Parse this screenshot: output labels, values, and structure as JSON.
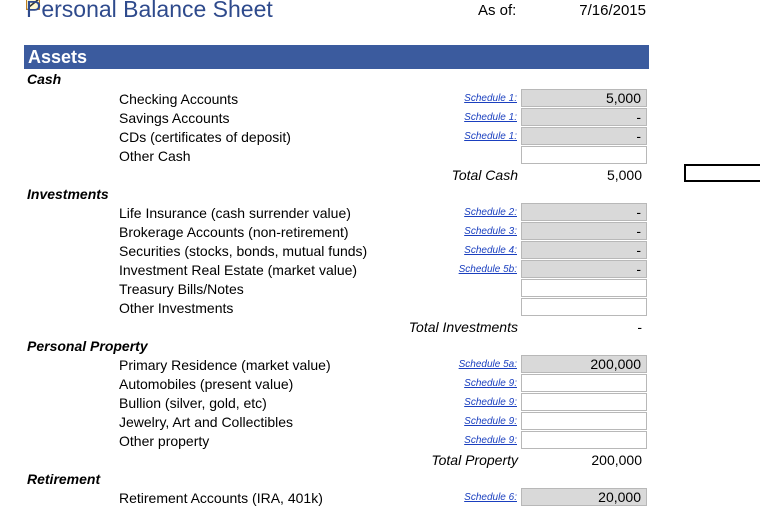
{
  "header": {
    "title": "Personal Balance Sheet",
    "as_of_label": "As of:",
    "as_of_date": "7/16/2015"
  },
  "assets_label": "Assets",
  "sections": {
    "cash": {
      "label": "Cash",
      "items": [
        {
          "name": "Checking Accounts",
          "schedule": "Schedule 1:",
          "value": "5,000"
        },
        {
          "name": "Savings Accounts",
          "schedule": "Schedule 1:",
          "value": "-"
        },
        {
          "name": "CDs (certificates of deposit)",
          "schedule": "Schedule 1:",
          "value": "-"
        },
        {
          "name": "Other Cash",
          "schedule": "",
          "value": ""
        }
      ],
      "total_label": "Total Cash",
      "total_value": "5,000"
    },
    "investments": {
      "label": "Investments",
      "items": [
        {
          "name": "Life Insurance (cash surrender value)",
          "schedule": "Schedule 2:",
          "value": "-"
        },
        {
          "name": "Brokerage Accounts (non-retirement)",
          "schedule": "Schedule 3:",
          "value": "-"
        },
        {
          "name": "Securities (stocks, bonds, mutual funds)",
          "schedule": "Schedule 4:",
          "value": "-"
        },
        {
          "name": "Investment Real Estate (market value)",
          "schedule": "Schedule 5b:",
          "value": "-"
        },
        {
          "name": "Treasury Bills/Notes",
          "schedule": "",
          "value": ""
        },
        {
          "name": "Other Investments",
          "schedule": "",
          "value": ""
        }
      ],
      "total_label": "Total Investments",
      "total_value": "-"
    },
    "property": {
      "label": "Personal Property",
      "items": [
        {
          "name": "Primary Residence (market value)",
          "schedule": "Schedule 5a:",
          "value": "200,000"
        },
        {
          "name": "Automobiles (present value)",
          "schedule": "Schedule 9:",
          "value": ""
        },
        {
          "name": "Bullion (silver, gold, etc)",
          "schedule": "Schedule 9:",
          "value": ""
        },
        {
          "name": "Jewelry, Art and Collectibles",
          "schedule": "Schedule 9:",
          "value": ""
        },
        {
          "name": "Other property",
          "schedule": "Schedule 9:",
          "value": ""
        }
      ],
      "total_label": "Total Property",
      "total_value": "200,000"
    },
    "retirement": {
      "label": "Retirement",
      "items": [
        {
          "name": "Retirement Accounts (IRA, 401k)",
          "schedule": "Schedule 6:",
          "value": "20,000"
        }
      ]
    }
  }
}
